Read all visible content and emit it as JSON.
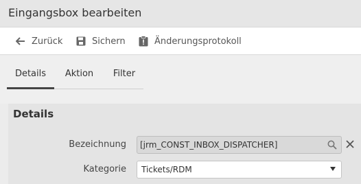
{
  "window": {
    "title": "Eingangsbox bearbeiten"
  },
  "toolbar": {
    "back_label": "Zurück",
    "save_label": "Sichern",
    "log_label": "Änderungsprotokoll",
    "icons": {
      "back": "arrow-left-icon",
      "save": "floppy-disk-icon",
      "log": "clipboard-alert-icon"
    }
  },
  "tabs": [
    {
      "label": "Details",
      "active": true
    },
    {
      "label": "Aktion",
      "active": false
    },
    {
      "label": "Filter",
      "active": false
    }
  ],
  "details": {
    "heading": "Details",
    "name_label": "Bezeichnung",
    "name_value": "[jrm_CONST_INBOX_DISPATCHER]",
    "category_label": "Kategorie",
    "category_value": "Tickets/RDM"
  },
  "colors": {
    "title_bg": "#e6e6e6",
    "toolbar_bg": "#ffffff",
    "panel_bg": "#e4e4e4",
    "tab_active": "#444444"
  }
}
